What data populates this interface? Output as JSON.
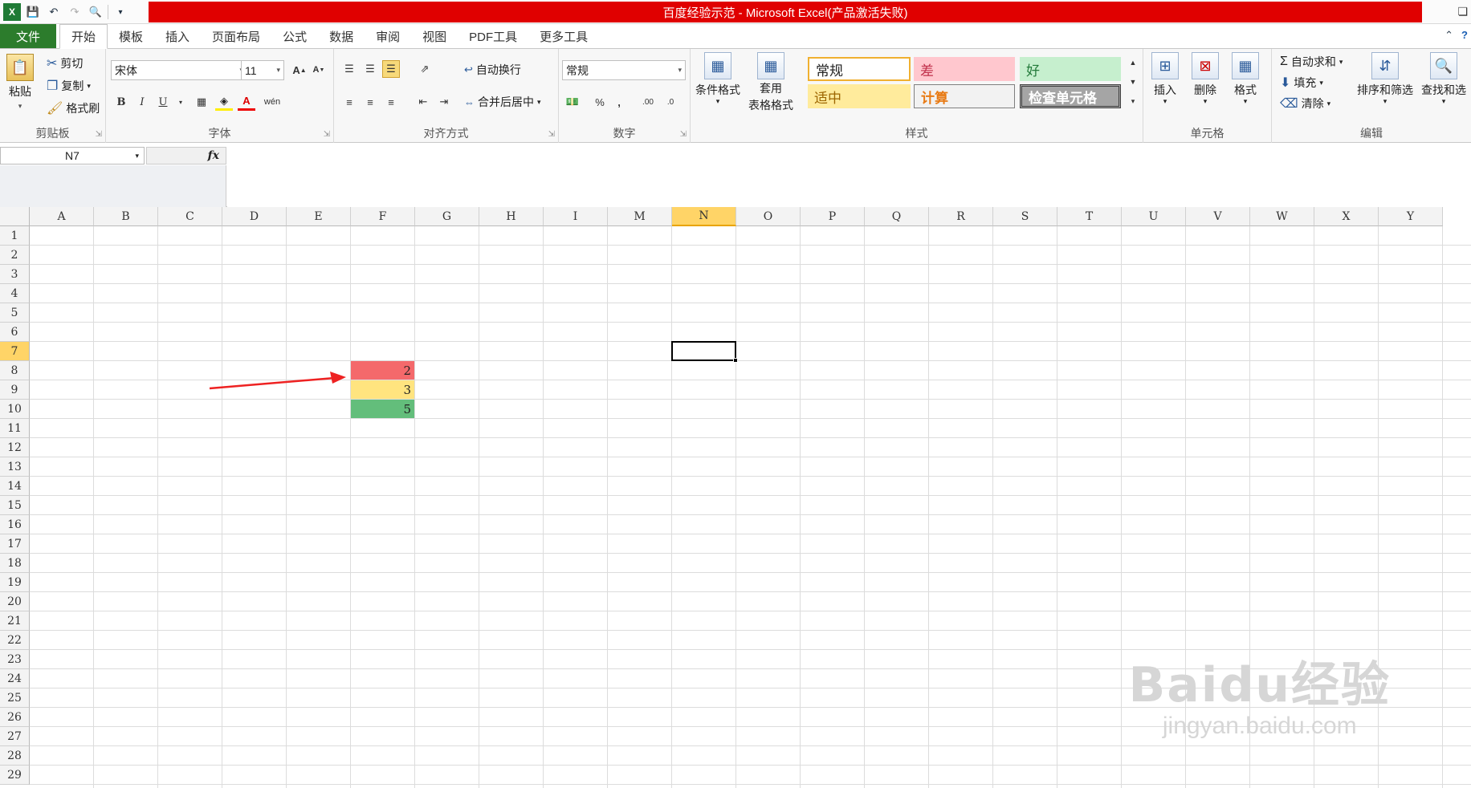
{
  "app": {
    "title": "百度经验示范 - Microsoft Excel(产品激活失败)",
    "accent_color": "#e00000"
  },
  "tabs": [
    {
      "label": "文件",
      "active": false
    },
    {
      "label": "开始",
      "active": true
    },
    {
      "label": "模板",
      "active": false
    },
    {
      "label": "插入",
      "active": false
    },
    {
      "label": "页面布局",
      "active": false
    },
    {
      "label": "公式",
      "active": false
    },
    {
      "label": "数据",
      "active": false
    },
    {
      "label": "审阅",
      "active": false
    },
    {
      "label": "视图",
      "active": false
    },
    {
      "label": "PDF工具",
      "active": false
    },
    {
      "label": "更多工具",
      "active": false
    }
  ],
  "ribbon": {
    "clipboard": {
      "label": "剪贴板",
      "paste": "粘贴",
      "cut": "剪切",
      "copy": "复制",
      "format_painter": "格式刷"
    },
    "font": {
      "label": "字体",
      "font_name": "宋体",
      "font_size": "11"
    },
    "alignment": {
      "label": "对齐方式",
      "wrap": "自动换行",
      "merge": "合并后居中"
    },
    "number": {
      "label": "数字",
      "format": "常规"
    },
    "styles": {
      "label": "样式",
      "conditional": "条件格式",
      "table_format_line1": "套用",
      "table_format_line2": "表格格式",
      "cells": [
        {
          "text": "常规",
          "bg": "#ffffff",
          "color": "#222222"
        },
        {
          "text": "差",
          "bg": "#ffc7ce",
          "color": "#c0304b"
        },
        {
          "text": "好",
          "bg": "#c6efce",
          "color": "#237a3a"
        },
        {
          "text": "适中",
          "bg": "#ffeb9c",
          "color": "#9c6500"
        },
        {
          "text": "计算",
          "bg": "#f2f2f2",
          "color": "#e87a14"
        },
        {
          "text": "检查单元格",
          "bg": "#a5a5a5",
          "color": "#ffffff"
        }
      ]
    },
    "cells_group": {
      "label": "单元格",
      "insert": "插入",
      "delete": "删除",
      "format": "格式"
    },
    "editing": {
      "label": "编辑",
      "autosum": "自动求和",
      "fill": "填充",
      "clear": "清除",
      "sort": "排序和筛选",
      "find": "查找和选"
    }
  },
  "formula_bar": {
    "name_box": "N7",
    "fx": "fx",
    "formula": ""
  },
  "grid": {
    "columns": [
      "A",
      "B",
      "C",
      "D",
      "E",
      "F",
      "G",
      "H",
      "I",
      "M",
      "N",
      "O",
      "P",
      "Q",
      "R",
      "S",
      "T",
      "U",
      "V",
      "W",
      "X",
      "Y"
    ],
    "selected_column": "N",
    "rows": [
      "1",
      "2",
      "3",
      "4",
      "5",
      "6",
      "7",
      "8",
      "9",
      "10",
      "11",
      "12",
      "13",
      "14",
      "15",
      "16",
      "17",
      "18",
      "19",
      "20",
      "21",
      "22",
      "23",
      "24",
      "25",
      "26",
      "27",
      "28",
      "29"
    ],
    "selected_row": "7",
    "values": [
      {
        "col": "F",
        "row": "8",
        "value": "2",
        "bg": "#f4696b"
      },
      {
        "col": "F",
        "row": "9",
        "value": "3",
        "bg": "#ffe47f"
      },
      {
        "col": "F",
        "row": "10",
        "value": "5",
        "bg": "#63be7b"
      }
    ],
    "arrow_color": "#ee2222"
  },
  "watermark": {
    "line1": "Baidu经验",
    "line2": "jingyan.baidu.com"
  }
}
